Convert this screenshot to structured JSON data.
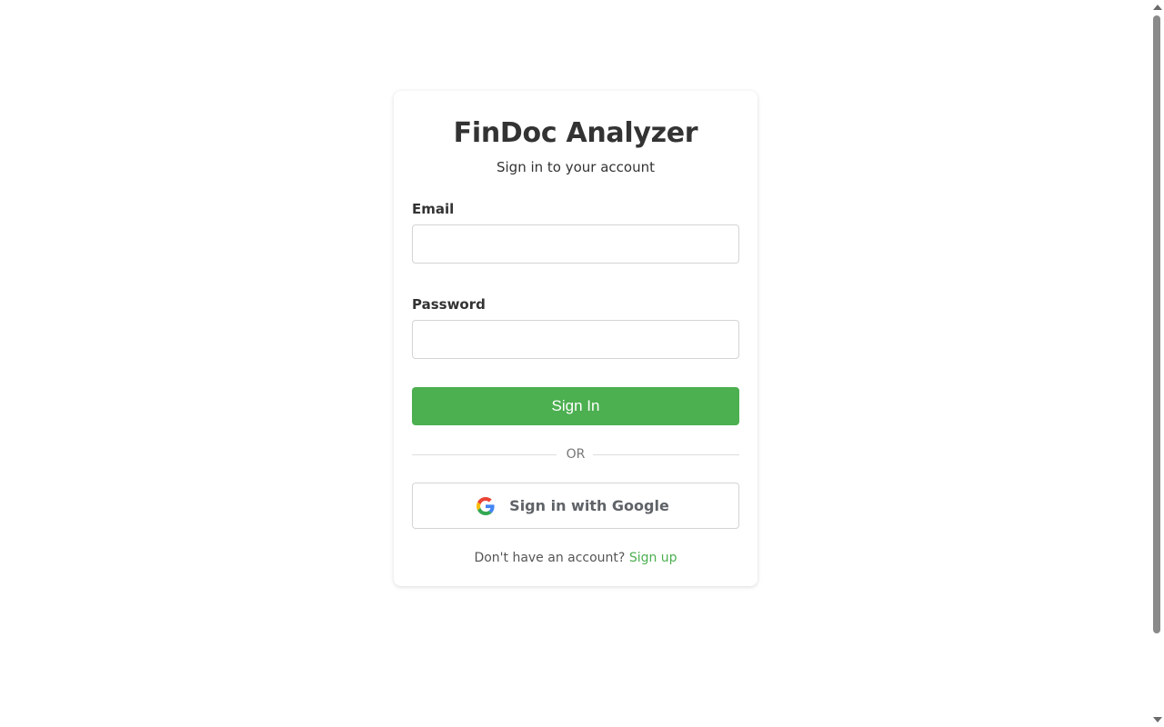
{
  "app": {
    "title": "FinDoc Analyzer",
    "subtitle": "Sign in to your account"
  },
  "form": {
    "email_label": "Email",
    "email_value": "",
    "password_label": "Password",
    "password_value": "",
    "submit_label": "Sign In"
  },
  "divider": {
    "text": "OR"
  },
  "google": {
    "label": "Sign in with Google",
    "icon": "google-g-icon"
  },
  "footer": {
    "prompt": "Don't have an account?",
    "link_label": "Sign up"
  },
  "colors": {
    "primary": "#4caf50",
    "text": "#333333",
    "border": "#d4d4d4"
  }
}
